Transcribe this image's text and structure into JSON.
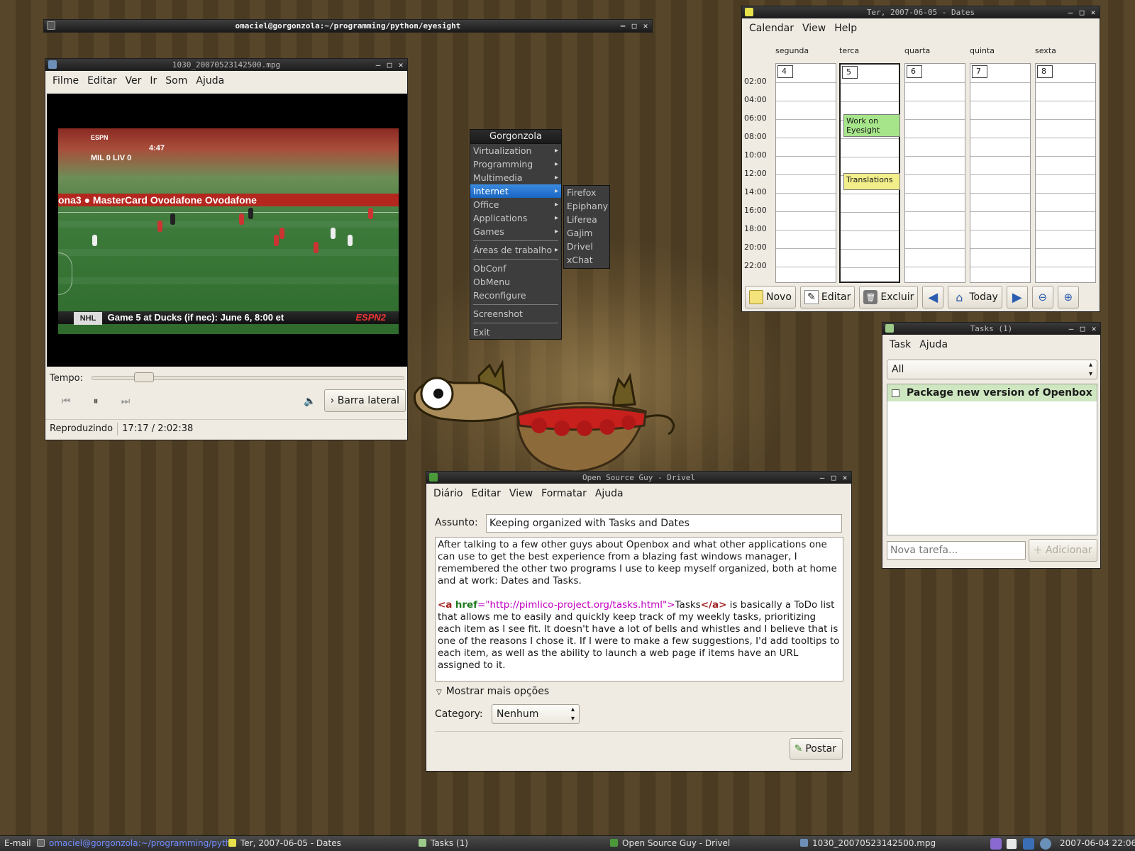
{
  "terminal": {
    "title": "omaciel@gorgonzola:~/programming/python/eyesight"
  },
  "player": {
    "title": "1030_20070523142500.mpg",
    "menu": [
      "Filme",
      "Editar",
      "Ver",
      "Ir",
      "Som",
      "Ajuda"
    ],
    "tempo_label": "Tempo:",
    "seek_fraction": 0.143,
    "sidebar_button": "Barra lateral",
    "status": "Reproduzindo",
    "time": "17:17 / 2:02:38",
    "video": {
      "clock": "4:47",
      "score_teams": "MIL 0 LIV 0",
      "board_text": "ona3 ● MasterCard   Ovodafone  Ovodafone",
      "ticker_league": "NHL",
      "ticker_text": "Game 5 at Ducks (if nec): June 6, 8:00 et",
      "ticker_brand": "ESPN2",
      "top_brand": "ESPN"
    }
  },
  "root_menu": {
    "title": "Gorgonzola",
    "items": [
      "Virtualization",
      "Programming",
      "Multimedia",
      "Internet",
      "Office",
      "Applications",
      "Games",
      "Áreas de trabalho",
      "ObConf",
      "ObMenu",
      "Reconfigure",
      "Screenshot",
      "Exit"
    ],
    "highlighted": "Internet",
    "submenu": [
      "Firefox",
      "Epiphany",
      "Liferea",
      "Gajim",
      "Drivel",
      "xChat"
    ]
  },
  "dates": {
    "title": "Ter, 2007-06-05 - Dates",
    "menu": [
      "Calendar",
      "View",
      "Help"
    ],
    "days": [
      {
        "name": "segunda",
        "num": "4"
      },
      {
        "name": "terca",
        "num": "5"
      },
      {
        "name": "quarta",
        "num": "6"
      },
      {
        "name": "quinta",
        "num": "7"
      },
      {
        "name": "sexta",
        "num": "8"
      }
    ],
    "hours": [
      "02:00",
      "04:00",
      "06:00",
      "08:00",
      "10:00",
      "12:00",
      "14:00",
      "16:00",
      "18:00",
      "20:00",
      "22:00"
    ],
    "events": [
      {
        "title": "Work on Eyesight",
        "color": "#a6e58a"
      },
      {
        "title": "Translations",
        "color": "#f2ee8a"
      }
    ],
    "toolbar": {
      "new": "Novo",
      "edit": "Editar",
      "delete": "Excluir",
      "today": "Today"
    }
  },
  "tasks": {
    "title": "Tasks (1)",
    "menu": [
      "Task",
      "Ajuda"
    ],
    "filter": "All",
    "items": [
      "Package new version of Openbox"
    ],
    "new_placeholder": "Nova tarefa...",
    "add_button": "Adicionar"
  },
  "drivel": {
    "title": "Open Source Guy - Drivel",
    "menu": [
      "Diário",
      "Editar",
      "View",
      "Formatar",
      "Ajuda"
    ],
    "subject_label": "Assunto:",
    "subject": "Keeping organized with Tasks and Dates",
    "para1": "After talking to a few other guys about Openbox and what other applications one can use to get the best experience from a blazing fast windows manager, I remembered the other two programs I use to keep myself organized, both at home and at work: Dates and Tasks.",
    "link_tag_open": "<a",
    "link_attr": "href",
    "link_eq": "=",
    "link_url": "\"http://pimlico-project.org/tasks.html\"",
    "link_close_bracket": ">",
    "link_text": "Tasks",
    "link_tag_close": "</a>",
    "para2": " is basically a ToDo list that allows me to easily and quickly keep track of my weekly tasks, prioritizing each item as I see fit.  It doesn't have a lot of bells and whistles and I believe that is one of the reasons I chose it.  If I were to make a few suggestions, I'd add tooltips to each item, as well as the ability to launch a web page if items have an URL assigned to it.",
    "more_options": "Mostrar mais opções",
    "category_label": "Category:",
    "category_value": "Nenhum",
    "post_button": "Postar"
  },
  "taskbar": {
    "items": [
      "E-mail",
      "omaciel@gorgonzola:~/programming/pyth",
      "Ter, 2007-06-05 - Dates",
      "Tasks (1)",
      "Open Source Guy - Drivel",
      "1030_20070523142500.mpg"
    ],
    "clock": "2007-06-04 22:06"
  },
  "colors": {
    "desktop": "#57462a",
    "highlight": "#1966c4",
    "task_row": "#cfe7c1"
  }
}
